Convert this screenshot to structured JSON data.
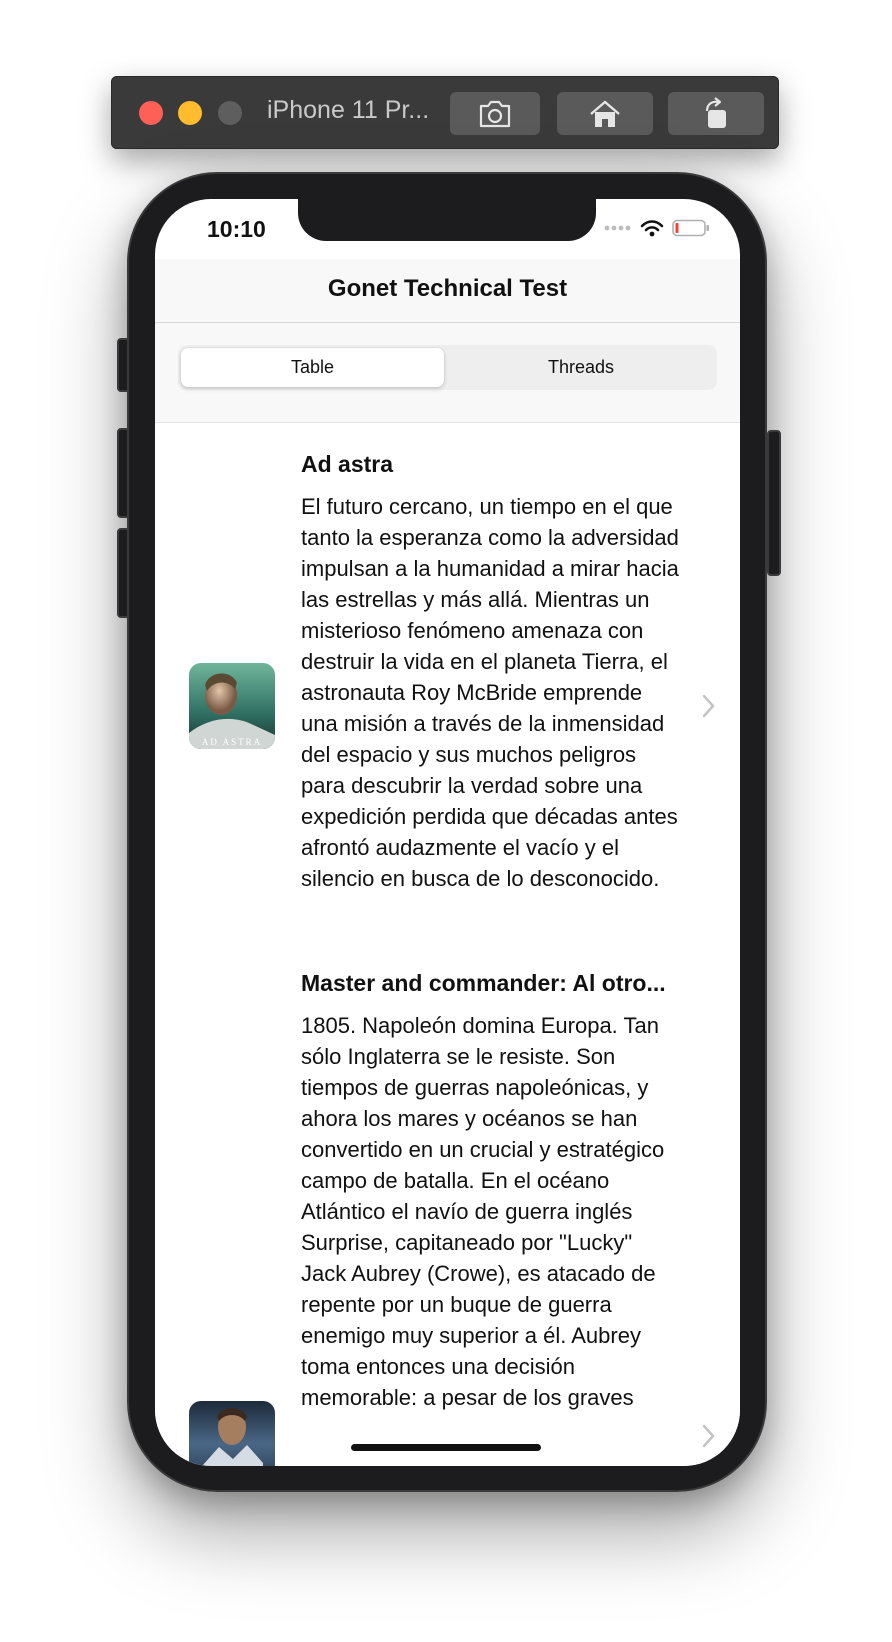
{
  "simulator": {
    "device_name": "iPhone 11 Pr...",
    "toolbar_icons": [
      "screenshot-icon",
      "home-icon",
      "rotate-icon"
    ]
  },
  "status_bar": {
    "time": "10:10",
    "icons": [
      "cellular-dots-icon",
      "wifi-icon",
      "battery-icon"
    ]
  },
  "nav": {
    "title": "Gonet Technical Test"
  },
  "segmented_control": {
    "options": [
      "Table",
      "Threads"
    ],
    "selected": "Table"
  },
  "movies": [
    {
      "title": "Ad astra",
      "overview": "El futuro cercano, un tiempo en el que tanto la esperanza como la adversidad impulsan a la humanidad a mirar hacia las estrellas y más allá. Mientras un misterioso fenómeno amenaza con destruir la vida en el planeta Tierra, el astronauta Roy McBride emprende una misión a través de la inmensidad del espacio y sus muchos peligros para descubrir la verdad sobre una expedición perdida que décadas antes afrontó audazmente el vacío y el silencio en busca de lo desconocido.",
      "poster_text": "AD ASTRA"
    },
    {
      "title": "Master and commander: Al otro...",
      "overview": "1805. Napoleón domina Europa. Tan sólo Inglaterra se le resiste. Son tiempos de guerras napoleónicas, y ahora los mares y océanos se han convertido en un crucial y estratégico campo de batalla. En el océano Atlántico el navío de guerra inglés Surprise, capitaneado por \"Lucky\" Jack Aubrey (Crowe), es atacado de repente por un buque de guerra enemigo muy superior a él. Aubrey toma entonces una decisión memorable: a pesar de los graves"
    }
  ]
}
